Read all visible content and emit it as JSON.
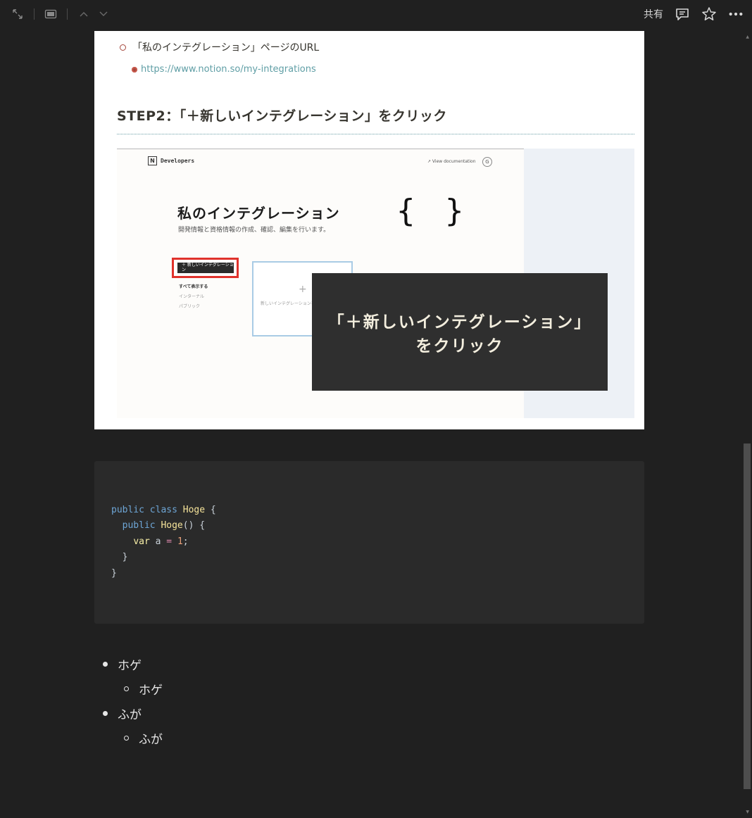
{
  "toolbar": {
    "share_label": "共有",
    "icons": [
      "expand-icon",
      "sidebar-panel-icon",
      "chevron-up-icon",
      "chevron-down-icon",
      "comment-icon",
      "star-icon",
      "more-icon"
    ]
  },
  "doc": {
    "sub_item_label": "「私のインテグレーション」ページのURL",
    "sub_sub_link": "https://www.notion.so/my-integrations",
    "step_heading": "STEP2：「＋新しいインテグレーション」をクリック",
    "screenshot": {
      "brand_logo_letter": "N",
      "brand_label": "Developers",
      "view_docs": "↗ View documentation",
      "avatar_letter": "G",
      "page_title": "私のインテグレーション",
      "page_desc": "開発情報と資格情報の作成、確認、編集を行います。",
      "braces": "{ }",
      "new_button": "＋ 新しいインテグレーション",
      "menu_all": "すべて表示する",
      "menu_internal": "インターナル",
      "menu_public": "パブリック",
      "card_plus": "+",
      "card_text": "新しいインテグレーションを作成する",
      "callout_line1": "「＋新しいインテグレーション」",
      "callout_line2": "をクリック"
    }
  },
  "code": {
    "lines": [
      "public class Hoge {",
      "  public Hoge() {",
      "    var a = 1;",
      "  }",
      "}"
    ]
  },
  "list": {
    "item1": "ホゲ",
    "item1_sub": "ホゲ",
    "item2": "ふが",
    "item2_sub": "ふが"
  },
  "colors": {
    "background": "#202020",
    "doc_bg": "#ffffff",
    "link": "#5f9ea5",
    "bullet_accent": "#a5473c",
    "callout_bg": "#2f2f2f",
    "highlight_red": "#e0322c"
  }
}
